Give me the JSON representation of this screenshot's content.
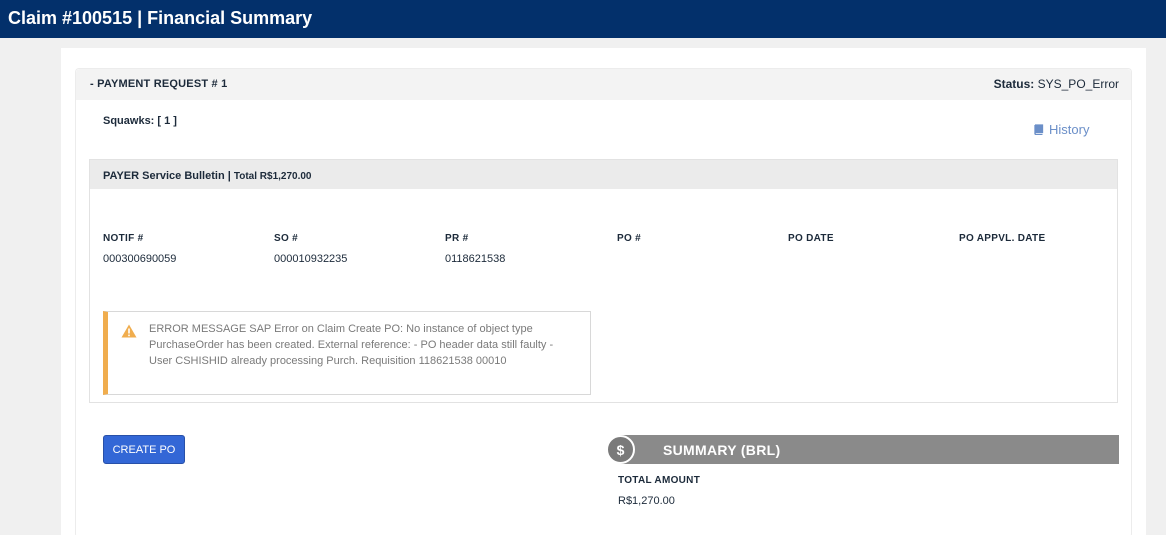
{
  "header": {
    "title": "Claim #100515 | Financial Summary"
  },
  "payment_request": {
    "title": "- PAYMENT REQUEST # 1",
    "status_label": "Status:",
    "status_value": "SYS_PO_Error",
    "squawks": "Squawks: [ 1 ]",
    "history_label": "History",
    "history_icon": "book-icon"
  },
  "payer": {
    "title": "PAYER Service Bulletin |",
    "total": "Total R$1,270.00",
    "columns": [
      {
        "label": "NOTIF #",
        "value": "000300690059"
      },
      {
        "label": "SO #",
        "value": "000010932235"
      },
      {
        "label": "PR #",
        "value": "0118621538"
      },
      {
        "label": "PO #",
        "value": ""
      },
      {
        "label": "PO DATE",
        "value": ""
      },
      {
        "label": "PO APPVL. DATE",
        "value": ""
      }
    ]
  },
  "error": {
    "icon": "warning-icon",
    "message": "ERROR MESSAGE SAP Error on Claim Create PO: No instance of object type PurchaseOrder has been created. External reference: - PO header data still faulty - User CSHISHID already processing Purch. Requisition 118621538 00010",
    "accent_color": "#f0ad4e"
  },
  "actions": {
    "create_po_label": "CREATE PO"
  },
  "summary": {
    "icon_glyph": "$",
    "title": "SUMMARY (BRL)",
    "total_label": "TOTAL AMOUNT",
    "total_value": "R$1,270.00"
  },
  "colors": {
    "topbar": "#03306b",
    "button": "#3367d6",
    "link": "#6b8fc8",
    "summary_bar": "#8a8a8a"
  }
}
